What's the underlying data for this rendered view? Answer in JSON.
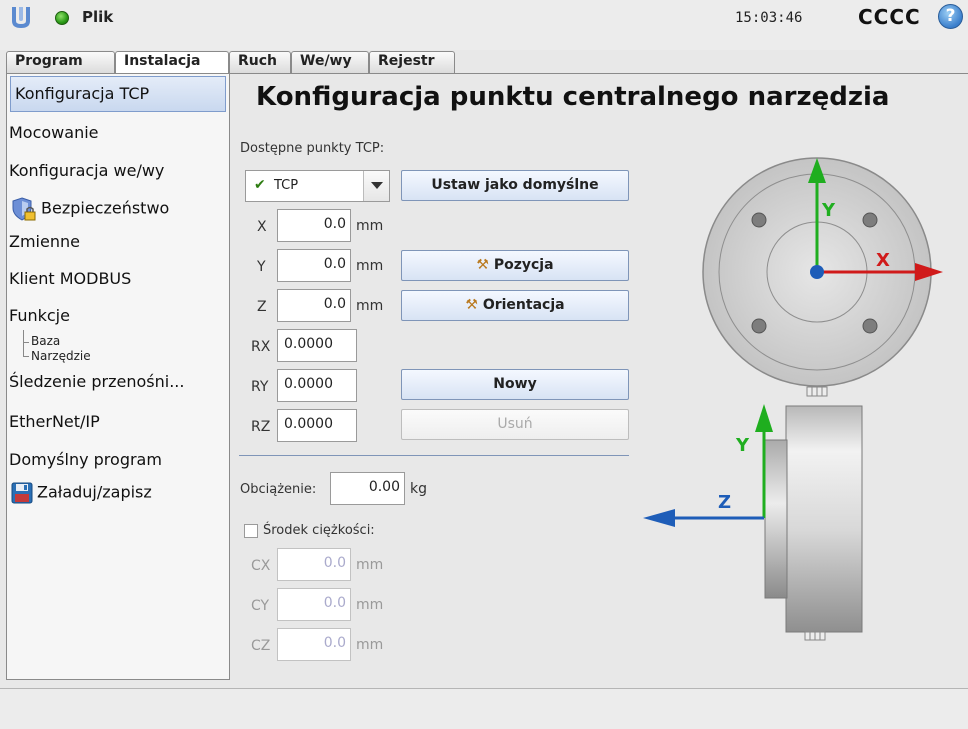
{
  "header": {
    "menu_label": "Plik",
    "clock": "15:03:46",
    "robot_name": "CCCC",
    "help_label": "?"
  },
  "tabs": [
    "Program",
    "Instalacja",
    "Ruch",
    "We/wy",
    "Rejestr"
  ],
  "active_tab": "Instalacja",
  "sidebar": {
    "items": [
      {
        "label": "Konfiguracja TCP",
        "selected": true
      },
      {
        "label": "Mocowanie"
      },
      {
        "label": "Konfiguracja we/wy"
      },
      {
        "label": "Bezpieczeństwo",
        "icon": "shield-lock-icon"
      },
      {
        "label": "Zmienne"
      },
      {
        "label": "Klient MODBUS"
      },
      {
        "label": "Funkcje"
      },
      {
        "label": "Śledzenie przenośni..."
      },
      {
        "label": "EtherNet/IP"
      },
      {
        "label": "Domyślny program"
      },
      {
        "label": "Załaduj/zapisz",
        "icon": "save-disk-icon"
      }
    ],
    "subitems": [
      "Baza",
      "Narzędzie"
    ]
  },
  "main": {
    "title": "Konfiguracja punktu centralnego narzędzia",
    "tcp_label": "Dostępne punkty TCP:",
    "tcp_selected": "TCP",
    "set_default_button": "Ustaw jako domyślne",
    "position_button": "Pozycja",
    "orientation_button": "Orientacja",
    "new_button": "Nowy",
    "delete_button": "Usuń",
    "coords": [
      {
        "label": "X",
        "value": "0.0",
        "unit": "mm"
      },
      {
        "label": "Y",
        "value": "0.0",
        "unit": "mm"
      },
      {
        "label": "Z",
        "value": "0.0",
        "unit": "mm"
      },
      {
        "label": "RX",
        "value": "0.0000"
      },
      {
        "label": "RY",
        "value": "0.0000"
      },
      {
        "label": "RZ",
        "value": "0.0000"
      }
    ],
    "payload_label": "Obciążenie:",
    "payload_value": "0.00",
    "payload_unit": "kg",
    "cog_label": "Środek ciężkości:",
    "cog_checked": false,
    "cog": [
      {
        "label": "CX",
        "value": "0.0",
        "unit": "mm"
      },
      {
        "label": "CY",
        "value": "0.0",
        "unit": "mm"
      },
      {
        "label": "CZ",
        "value": "0.0",
        "unit": "mm"
      }
    ]
  },
  "diagram": {
    "x_axis": "X",
    "y_axis_top": "Y",
    "y_axis_side": "Y",
    "z_axis": "Z",
    "colors": {
      "x": "#d01a1a",
      "y": "#1fae1f",
      "z": "#1e5db8"
    }
  }
}
